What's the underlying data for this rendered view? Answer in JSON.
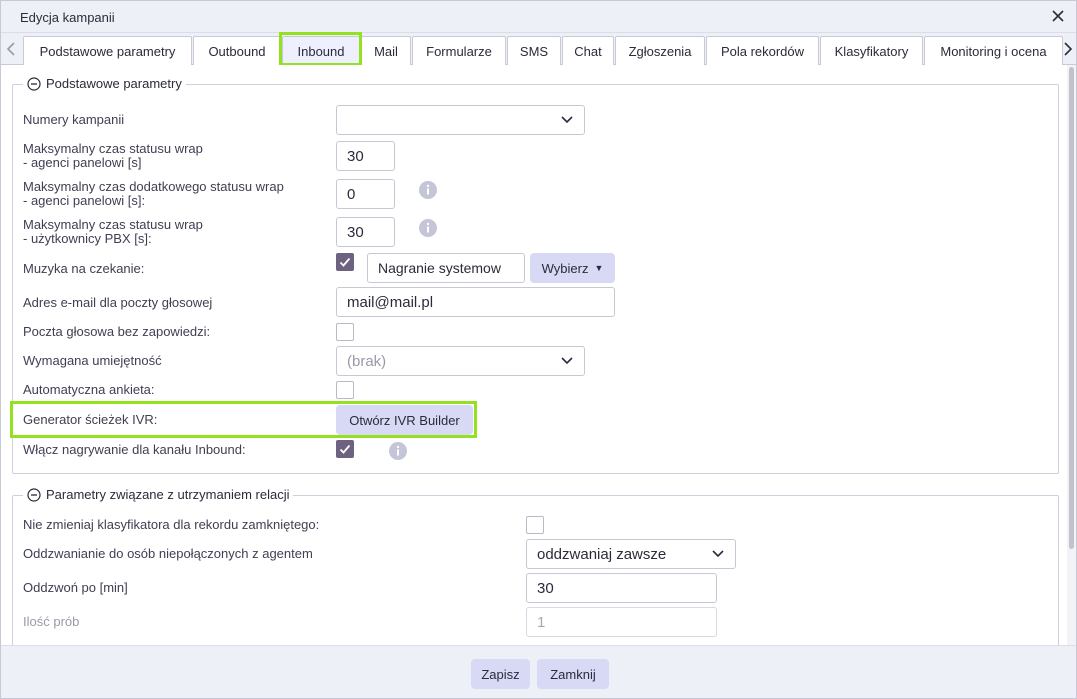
{
  "window": {
    "title": "Edycja kampanii"
  },
  "tabs": [
    {
      "label": "Podstawowe parametry"
    },
    {
      "label": "Outbound"
    },
    {
      "label": "Inbound"
    },
    {
      "label": "Mail"
    },
    {
      "label": "Formularze"
    },
    {
      "label": "SMS"
    },
    {
      "label": "Chat"
    },
    {
      "label": "Zgłoszenia"
    },
    {
      "label": "Pola rekordów"
    },
    {
      "label": "Klasyfikatory"
    },
    {
      "label": "Monitoring i ocena"
    }
  ],
  "active_tab": "Inbound",
  "section1": {
    "title": "Podstawowe parametry",
    "numery_label": "Numery kampanii",
    "numery_value": "",
    "wrap_label_1": "Maksymalny czas statusu wrap",
    "wrap_label_2": "- agenci panelowi [s]",
    "wrap_value": "30",
    "extra_wrap_label_1": "Maksymalny czas dodatkowego statusu wrap",
    "extra_wrap_label_2": "- agenci panelowi [s]:",
    "extra_wrap_value": "0",
    "pbx_wrap_label_1": "Maksymalny czas statusu wrap",
    "pbx_wrap_label_2": "- użytkownicy PBX [s]:",
    "pbx_wrap_value": "30",
    "music_label": "Muzyka na czekanie:",
    "music_checked": true,
    "music_value": "Nagranie systemow",
    "music_button": "Wybierz",
    "email_label": "Adres e-mail dla poczty głosowej",
    "email_value": "mail@mail.pl",
    "voicemail_label": "Poczta głosowa bez zapowiedzi:",
    "voicemail_checked": false,
    "skill_label": "Wymagana umiejętność",
    "skill_value": "(brak)",
    "survey_label": "Automatyczna ankieta:",
    "survey_checked": false,
    "ivr_label": "Generator ścieżek IVR:",
    "ivr_button": "Otwórz IVR Builder",
    "recording_label": "Włącz nagrywanie dla kanału Inbound:",
    "recording_checked": true
  },
  "section2": {
    "title": "Parametry związane z utrzymaniem relacji",
    "keep_classifier_label": "Nie zmieniaj klasyfikatora dla rekordu zamkniętego:",
    "keep_classifier_checked": false,
    "callback_label": "Oddzwanianie do osób niepołączonych z agentem",
    "callback_value": "oddzwaniaj zawsze",
    "callback_after_label": "Oddzwoń po [min]",
    "callback_after_value": "30",
    "attempts_label": "Ilość prób",
    "attempts_value": "1"
  },
  "footer": {
    "save_label": "Zapisz",
    "close_label": "Zamknij"
  },
  "colors": {
    "highlight": "#93e11f",
    "button": "#d7d9f5",
    "checkbox_checked": "#6d6380"
  },
  "icons": [
    "close-icon",
    "chevron-left-icon",
    "chevron-right-icon",
    "collapse-icon",
    "chevron-down-icon",
    "info-icon",
    "check-icon",
    "caret-down-icon"
  ]
}
